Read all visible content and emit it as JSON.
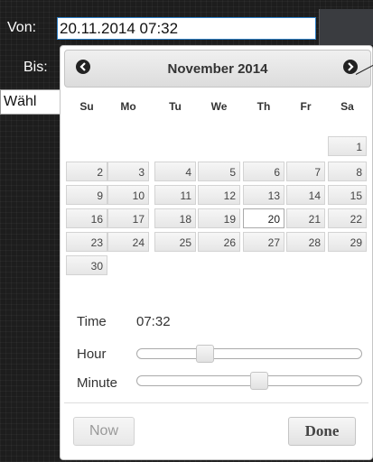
{
  "form": {
    "from_label": "Von:",
    "from_value": "20.11.2014 07:32",
    "to_label": "Bis:",
    "select_text": "Wähl"
  },
  "picker": {
    "month_title": "November 2014",
    "prev_icon": "prev-circle-icon",
    "next_icon": "next-circle-icon",
    "weekdays": [
      "Su",
      "Mo",
      "Tu",
      "We",
      "Th",
      "Fr",
      "Sa"
    ],
    "weeks": [
      [
        "",
        "",
        "",
        "",
        "",
        "",
        "1"
      ],
      [
        "2",
        "3",
        "4",
        "5",
        "6",
        "7",
        "8"
      ],
      [
        "9",
        "10",
        "11",
        "12",
        "13",
        "14",
        "15"
      ],
      [
        "16",
        "17",
        "18",
        "19",
        "20",
        "21",
        "22"
      ],
      [
        "23",
        "24",
        "25",
        "26",
        "27",
        "28",
        "29"
      ],
      [
        "30",
        "",
        "",
        "",
        "",
        "",
        ""
      ]
    ],
    "selected_day": "20",
    "time_label": "Time",
    "time_value": "07:32",
    "hour_label": "Hour",
    "hour_value": 7,
    "hour_max": 23,
    "minute_label": "Minute",
    "minute_value": 32,
    "minute_max": 59,
    "now_label": "Now",
    "done_label": "Done"
  }
}
